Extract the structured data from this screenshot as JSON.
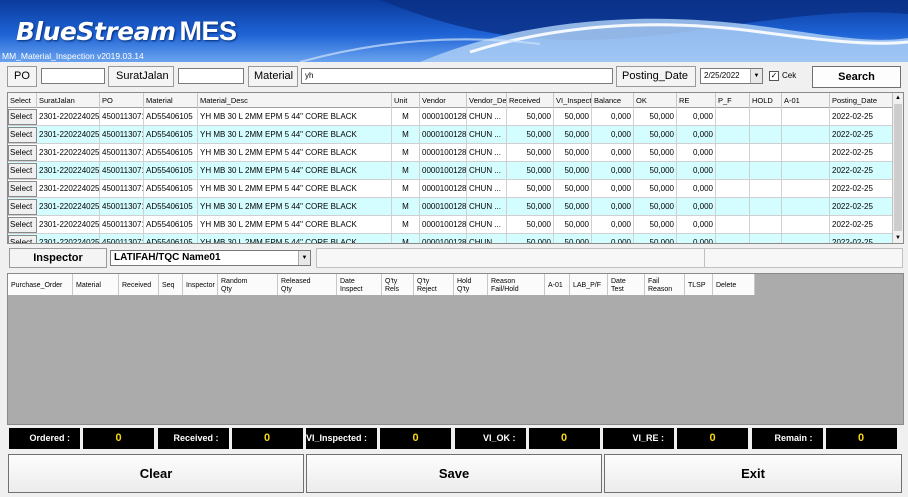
{
  "header": {
    "logo": "BlueStream",
    "logo_suffix": "MES",
    "subtitle": "MM_Material_Inspection v2019.03.14"
  },
  "filter": {
    "po_label": "PO",
    "po_value": "",
    "surat_label": "SuratJalan",
    "surat_value": "",
    "material_label": "Material",
    "material_value": "yh",
    "posting_label": "Posting_Date",
    "posting_value": "2/25/2022",
    "cek_label": "Cek",
    "cek_checked": "✓",
    "search_label": "Search"
  },
  "grid1": {
    "columns": [
      "Select",
      "SuratJalan",
      "PO",
      "Material",
      "Material_Desc",
      "Unit",
      "Vendor",
      "Vendor_De",
      "Received",
      "VI_Inspected",
      "Balance",
      "OK",
      "RE",
      "P_F",
      "HOLD",
      "A-01",
      "Posting_Date"
    ],
    "rows": [
      [
        "Select",
        "2301-220224025",
        "4500113071",
        "AD55406105",
        "YH MB 30 L 2MM EPM 5 44\" CORE BLACK",
        "M",
        "0000100128",
        "CHUN ...",
        "50,000",
        "50,000",
        "0,000",
        "50,000",
        "0,000",
        "",
        "",
        "",
        "2022-02-25"
      ],
      [
        "Select",
        "2301-220224025",
        "4500113071",
        "AD55406105",
        "YH MB 30 L 2MM EPM 5 44\" CORE BLACK",
        "M",
        "0000100128",
        "CHUN ...",
        "50,000",
        "50,000",
        "0,000",
        "50,000",
        "0,000",
        "",
        "",
        "",
        "2022-02-25"
      ],
      [
        "Select",
        "2301-220224025",
        "4500113071",
        "AD55406105",
        "YH MB 30 L 2MM EPM 5 44\" CORE BLACK",
        "M",
        "0000100128",
        "CHUN ...",
        "50,000",
        "50,000",
        "0,000",
        "50,000",
        "0,000",
        "",
        "",
        "",
        "2022-02-25"
      ],
      [
        "Select",
        "2301-220224025",
        "4500113071",
        "AD55406105",
        "YH MB 30 L 2MM EPM 5 44\" CORE BLACK",
        "M",
        "0000100128",
        "CHUN ...",
        "50,000",
        "50,000",
        "0,000",
        "50,000",
        "0,000",
        "",
        "",
        "",
        "2022-02-25"
      ],
      [
        "Select",
        "2301-220224025",
        "4500113071",
        "AD55406105",
        "YH MB 30 L 2MM EPM 5 44\" CORE BLACK",
        "M",
        "0000100128",
        "CHUN ...",
        "50,000",
        "50,000",
        "0,000",
        "50,000",
        "0,000",
        "",
        "",
        "",
        "2022-02-25"
      ],
      [
        "Select",
        "2301-220224025",
        "4500113071",
        "AD55406105",
        "YH MB 30 L 2MM EPM 5 44\" CORE BLACK",
        "M",
        "0000100128",
        "CHUN ...",
        "50,000",
        "50,000",
        "0,000",
        "50,000",
        "0,000",
        "",
        "",
        "",
        "2022-02-25"
      ],
      [
        "Select",
        "2301-220224025",
        "4500113071",
        "AD55406105",
        "YH MB 30 L 2MM EPM 5 44\" CORE BLACK",
        "M",
        "0000100128",
        "CHUN ...",
        "50,000",
        "50,000",
        "0,000",
        "50,000",
        "0,000",
        "",
        "",
        "",
        "2022-02-25"
      ],
      [
        "Select",
        "2301-220224025",
        "4500113071",
        "AD55406105",
        "YH MB 30 L 2MM EPM 5 44\" CORE BLACK",
        "M",
        "0000100128",
        "CHUN ...",
        "50,000",
        "50,000",
        "0,000",
        "50,000",
        "0,000",
        "",
        "",
        "",
        "2022-02-25"
      ]
    ]
  },
  "inspector": {
    "label": "Inspector",
    "value": "LATIFAH/TQC Name01"
  },
  "grid2": {
    "columns": [
      "Purchase_Order",
      "Material",
      "Received",
      "Seq",
      "Inspector",
      "Random\nQty",
      "Released\nQty",
      "Date\nInspect",
      "Q'ty\nRels",
      "Q'ty\nReject",
      "Hold\nQ'ty",
      "Reason\nFail/Hold",
      "A-01",
      "LAB_P/F",
      "Date\nTest",
      "Fail\nReason",
      "TLSP",
      "Delete"
    ]
  },
  "summary": [
    {
      "label": "Ordered :",
      "value": "0"
    },
    {
      "label": "Received :",
      "value": "0"
    },
    {
      "label": "VI_Inspected :",
      "value": "0"
    },
    {
      "label": "VI_OK :",
      "value": "0"
    },
    {
      "label": "VI_RE :",
      "value": "0"
    },
    {
      "label": "Remain :",
      "value": "0"
    }
  ],
  "actions": {
    "clear": "Clear",
    "save": "Save",
    "exit": "Exit"
  }
}
